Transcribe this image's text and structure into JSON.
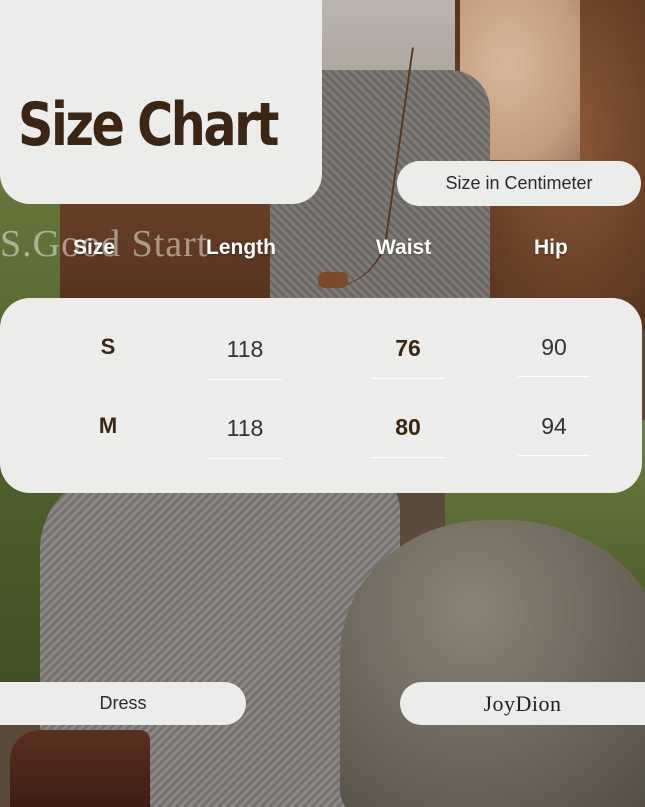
{
  "title": "Size Chart",
  "unit_note": "Size in Centimeter",
  "watermark": "S.Good Start",
  "headers": [
    "Size",
    "Length",
    "Waist",
    "Hip"
  ],
  "rows": [
    {
      "size": "S",
      "length": "118",
      "waist": "76",
      "hip": "90"
    },
    {
      "size": "M",
      "length": "118",
      "waist": "80",
      "hip": "94"
    }
  ],
  "category": "Dress",
  "brand": "JoyDion",
  "colors": {
    "title": "#3a2613",
    "card_bg": "#ececea",
    "header_text": "#ffffff"
  }
}
